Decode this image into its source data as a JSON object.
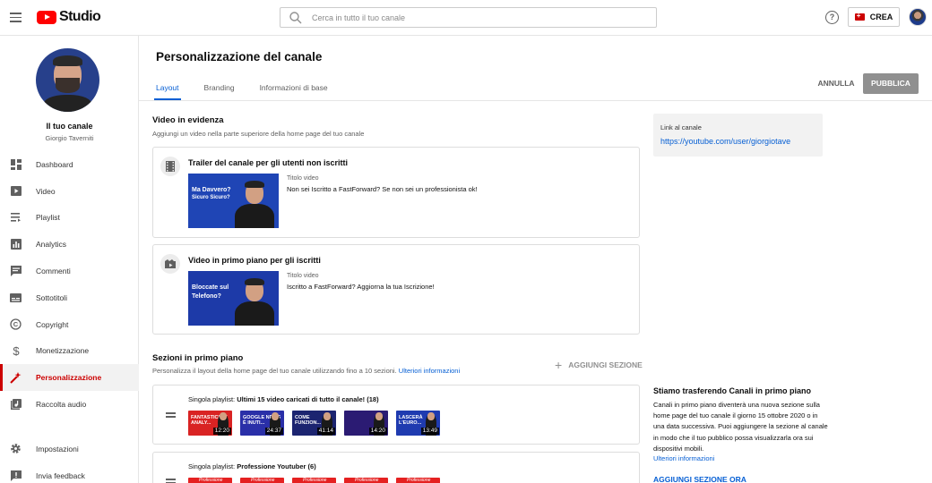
{
  "header": {
    "app_name": "Studio",
    "search_placeholder": "Cerca in tutto il tuo canale",
    "help_symbol": "?",
    "create_label": "CREA"
  },
  "sidebar": {
    "channel_title": "Il tuo canale",
    "channel_name": "Giorgio Taverniti",
    "items": [
      {
        "label": "Dashboard",
        "icon": "dashboard-icon"
      },
      {
        "label": "Video",
        "icon": "video-icon"
      },
      {
        "label": "Playlist",
        "icon": "playlist-icon"
      },
      {
        "label": "Analytics",
        "icon": "analytics-icon"
      },
      {
        "label": "Commenti",
        "icon": "comments-icon"
      },
      {
        "label": "Sottotitoli",
        "icon": "subtitles-icon"
      },
      {
        "label": "Copyright",
        "icon": "copyright-icon"
      },
      {
        "label": "Monetizzazione",
        "icon": "dollar-icon"
      },
      {
        "label": "Personalizzazione",
        "icon": "magic-wand-icon",
        "active": true
      },
      {
        "label": "Raccolta audio",
        "icon": "audio-library-icon"
      }
    ],
    "bottom_items": [
      {
        "label": "Impostazioni",
        "icon": "gear-icon"
      },
      {
        "label": "Invia feedback",
        "icon": "feedback-icon"
      }
    ]
  },
  "main": {
    "title": "Personalizzazione del canale",
    "tabs": [
      {
        "label": "Layout",
        "active": true
      },
      {
        "label": "Branding"
      },
      {
        "label": "Informazioni di base"
      }
    ],
    "cancel_label": "ANNULLA",
    "publish_label": "PUBBLICA",
    "featured": {
      "title": "Video in evidenza",
      "description": "Aggiungi un video nella parte superiore della home page del tuo canale",
      "trailer": {
        "title": "Trailer del canale per gli utenti non iscritti",
        "thumb_text_1": "Ma Davvero?",
        "thumb_text_2": "Sicuro Sicuro?",
        "meta_label": "Titolo video",
        "meta_value": "Non sei Iscritto a FastForward? Se non sei un professionista ok!"
      },
      "subscribers": {
        "title": "Video in primo piano per gli iscritti",
        "thumb_text_1": "Bloccate sul",
        "thumb_text_2": "Telefono?",
        "meta_label": "Titolo video",
        "meta_value": "Iscritto a FastForward? Aggiorna la tua Iscrizione!"
      }
    },
    "channel_link": {
      "label": "Link al canale",
      "url": "https://youtube.com/user/giorgiotave"
    },
    "sections": {
      "title": "Sezioni in primo piano",
      "description": "Personalizza il layout della home page del tuo canale utilizzando fino a 10 sezioni.",
      "link": "Ulteriori informazioni",
      "add_label": "AGGIUNGI SEZIONE",
      "playlists": [
        {
          "prefix": "Singola playlist:",
          "name": "Ultimi 15 video caricati di tutto il canale! (18)",
          "thumbs": [
            {
              "text": "FANTASTICI YT ANALY...",
              "duration": "12:20",
              "color": "#d92323"
            },
            {
              "text": "GOOGLE NEWS È INUTI...",
              "duration": "24:37",
              "color": "#2a2fa8"
            },
            {
              "text": "COME FUNZION...",
              "duration": "41:14",
              "color": "#1c2470"
            },
            {
              "text": "",
              "duration": "14:20",
              "color": "#2b1b73"
            },
            {
              "text": "LASCERÀ L'EURO...",
              "duration": "13:49",
              "color": "#1f3bb0"
            }
          ]
        },
        {
          "prefix": "Singola playlist:",
          "name": "Professione Youtuber (6)",
          "thumbs": [
            {
              "text": "Professione"
            },
            {
              "text": "Professione"
            },
            {
              "text": "Professione"
            },
            {
              "text": "Professione"
            },
            {
              "text": "Professione"
            }
          ]
        }
      ]
    },
    "info": {
      "title": "Stiamo trasferendo Canali in primo piano",
      "text": "Canali in primo piano diventerà una nuova sezione sulla home page del tuo canale il giorno 15 ottobre 2020 o in una data successiva. Puoi aggiungere la sezione al canale in modo che il tuo pubblico possa visualizzarla ora sui dispositivi mobili.",
      "link": "Ulteriori informazioni",
      "cta": "AGGIUNGI SEZIONE ORA"
    }
  }
}
